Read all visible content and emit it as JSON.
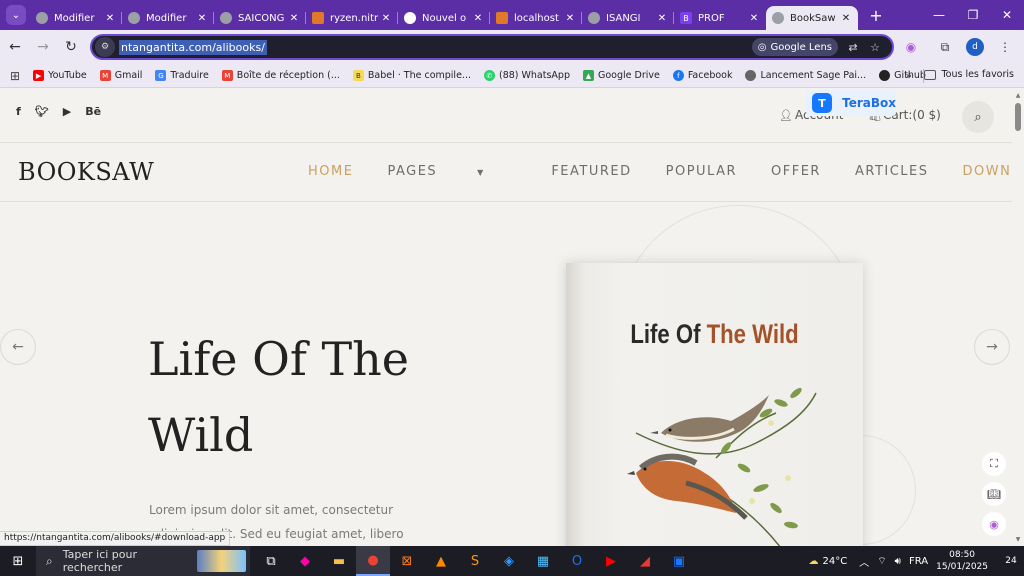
{
  "browser": {
    "tabs": [
      {
        "title": "Modifier",
        "favicon": "globe-icon",
        "color": "#9aa0a6"
      },
      {
        "title": "Modifier",
        "favicon": "globe-icon",
        "color": "#9aa0a6"
      },
      {
        "title": "SAICONG",
        "favicon": "globe-icon",
        "color": "#9aa0a6"
      },
      {
        "title": "ryzen.nitr",
        "favicon": "flame-icon",
        "color": "#e0782a"
      },
      {
        "title": "Nouvel o",
        "favicon": "github-icon",
        "color": "#ffffff"
      },
      {
        "title": "localhost",
        "favicon": "flame-icon",
        "color": "#e0782a"
      },
      {
        "title": "ISANGI",
        "favicon": "globe-icon",
        "color": "#9aa0a6"
      },
      {
        "title": "PROF",
        "favicon": "bootstrap-icon",
        "color": "#7a3ff0"
      },
      {
        "title": "BookSaw",
        "favicon": "globe-icon",
        "color": "#9aa0a6",
        "active": true
      }
    ],
    "omnibox": {
      "url": "ntangantita.com/alibooks/",
      "lens_label": "Google Lens"
    },
    "profile_initial": "d",
    "bookmarks": [
      {
        "label": "YouTube",
        "icon": "youtube-icon",
        "color": "#ff0000"
      },
      {
        "label": "Gmail",
        "icon": "gmail-icon",
        "color": "#ea4335"
      },
      {
        "label": "Traduire",
        "icon": "translate-icon",
        "color": "#4285f4"
      },
      {
        "label": "Boîte de réception (...",
        "icon": "gmail-icon",
        "color": "#ea4335"
      },
      {
        "label": "Babel · The compile...",
        "icon": "babel-icon",
        "color": "#f5da55"
      },
      {
        "label": "(88) WhatsApp",
        "icon": "whatsapp-icon",
        "color": "#25d366"
      },
      {
        "label": "Google Drive",
        "icon": "drive-icon",
        "color": "#34a853"
      },
      {
        "label": "Facebook",
        "icon": "facebook-icon",
        "color": "#1877f2"
      },
      {
        "label": "Lancement Sage Pai...",
        "icon": "globe-icon",
        "color": "#666666"
      },
      {
        "label": "Github",
        "icon": "github-icon",
        "color": "#222222"
      }
    ],
    "all_bookmarks_label": "Tous les favoris",
    "status_url": "https://ntangantita.com/alibooks/#download-app"
  },
  "site": {
    "account_label": "Account",
    "cart_label": "Cart:(0 $)",
    "terabox_label": "TeraBox",
    "brand": "BOOKSAW",
    "menu": [
      {
        "label": "HOME"
      },
      {
        "label": "PAGES"
      },
      {
        "label": "FEATURED"
      },
      {
        "label": "POPULAR"
      },
      {
        "label": "OFFER"
      },
      {
        "label": "ARTICLES"
      },
      {
        "label": "DOWNLOAD APP"
      }
    ],
    "hero": {
      "title": "Life Of The Wild",
      "text": "Lorem ipsum dolor sit amet, consectetur adipiscing elit. Sed eu feugiat amet, libero ipsum enim pharetra",
      "book_title_a": "Life Of ",
      "book_title_b": "The Wild"
    },
    "colors": {
      "accent": "#c9a063",
      "book_accent": "#a4522a"
    }
  },
  "taskbar": {
    "search_placeholder": "Taper ici pour rechercher",
    "weather": "24°C",
    "language": "FRA",
    "time": "08:50",
    "date": "15/01/2025",
    "notifications": "24"
  }
}
